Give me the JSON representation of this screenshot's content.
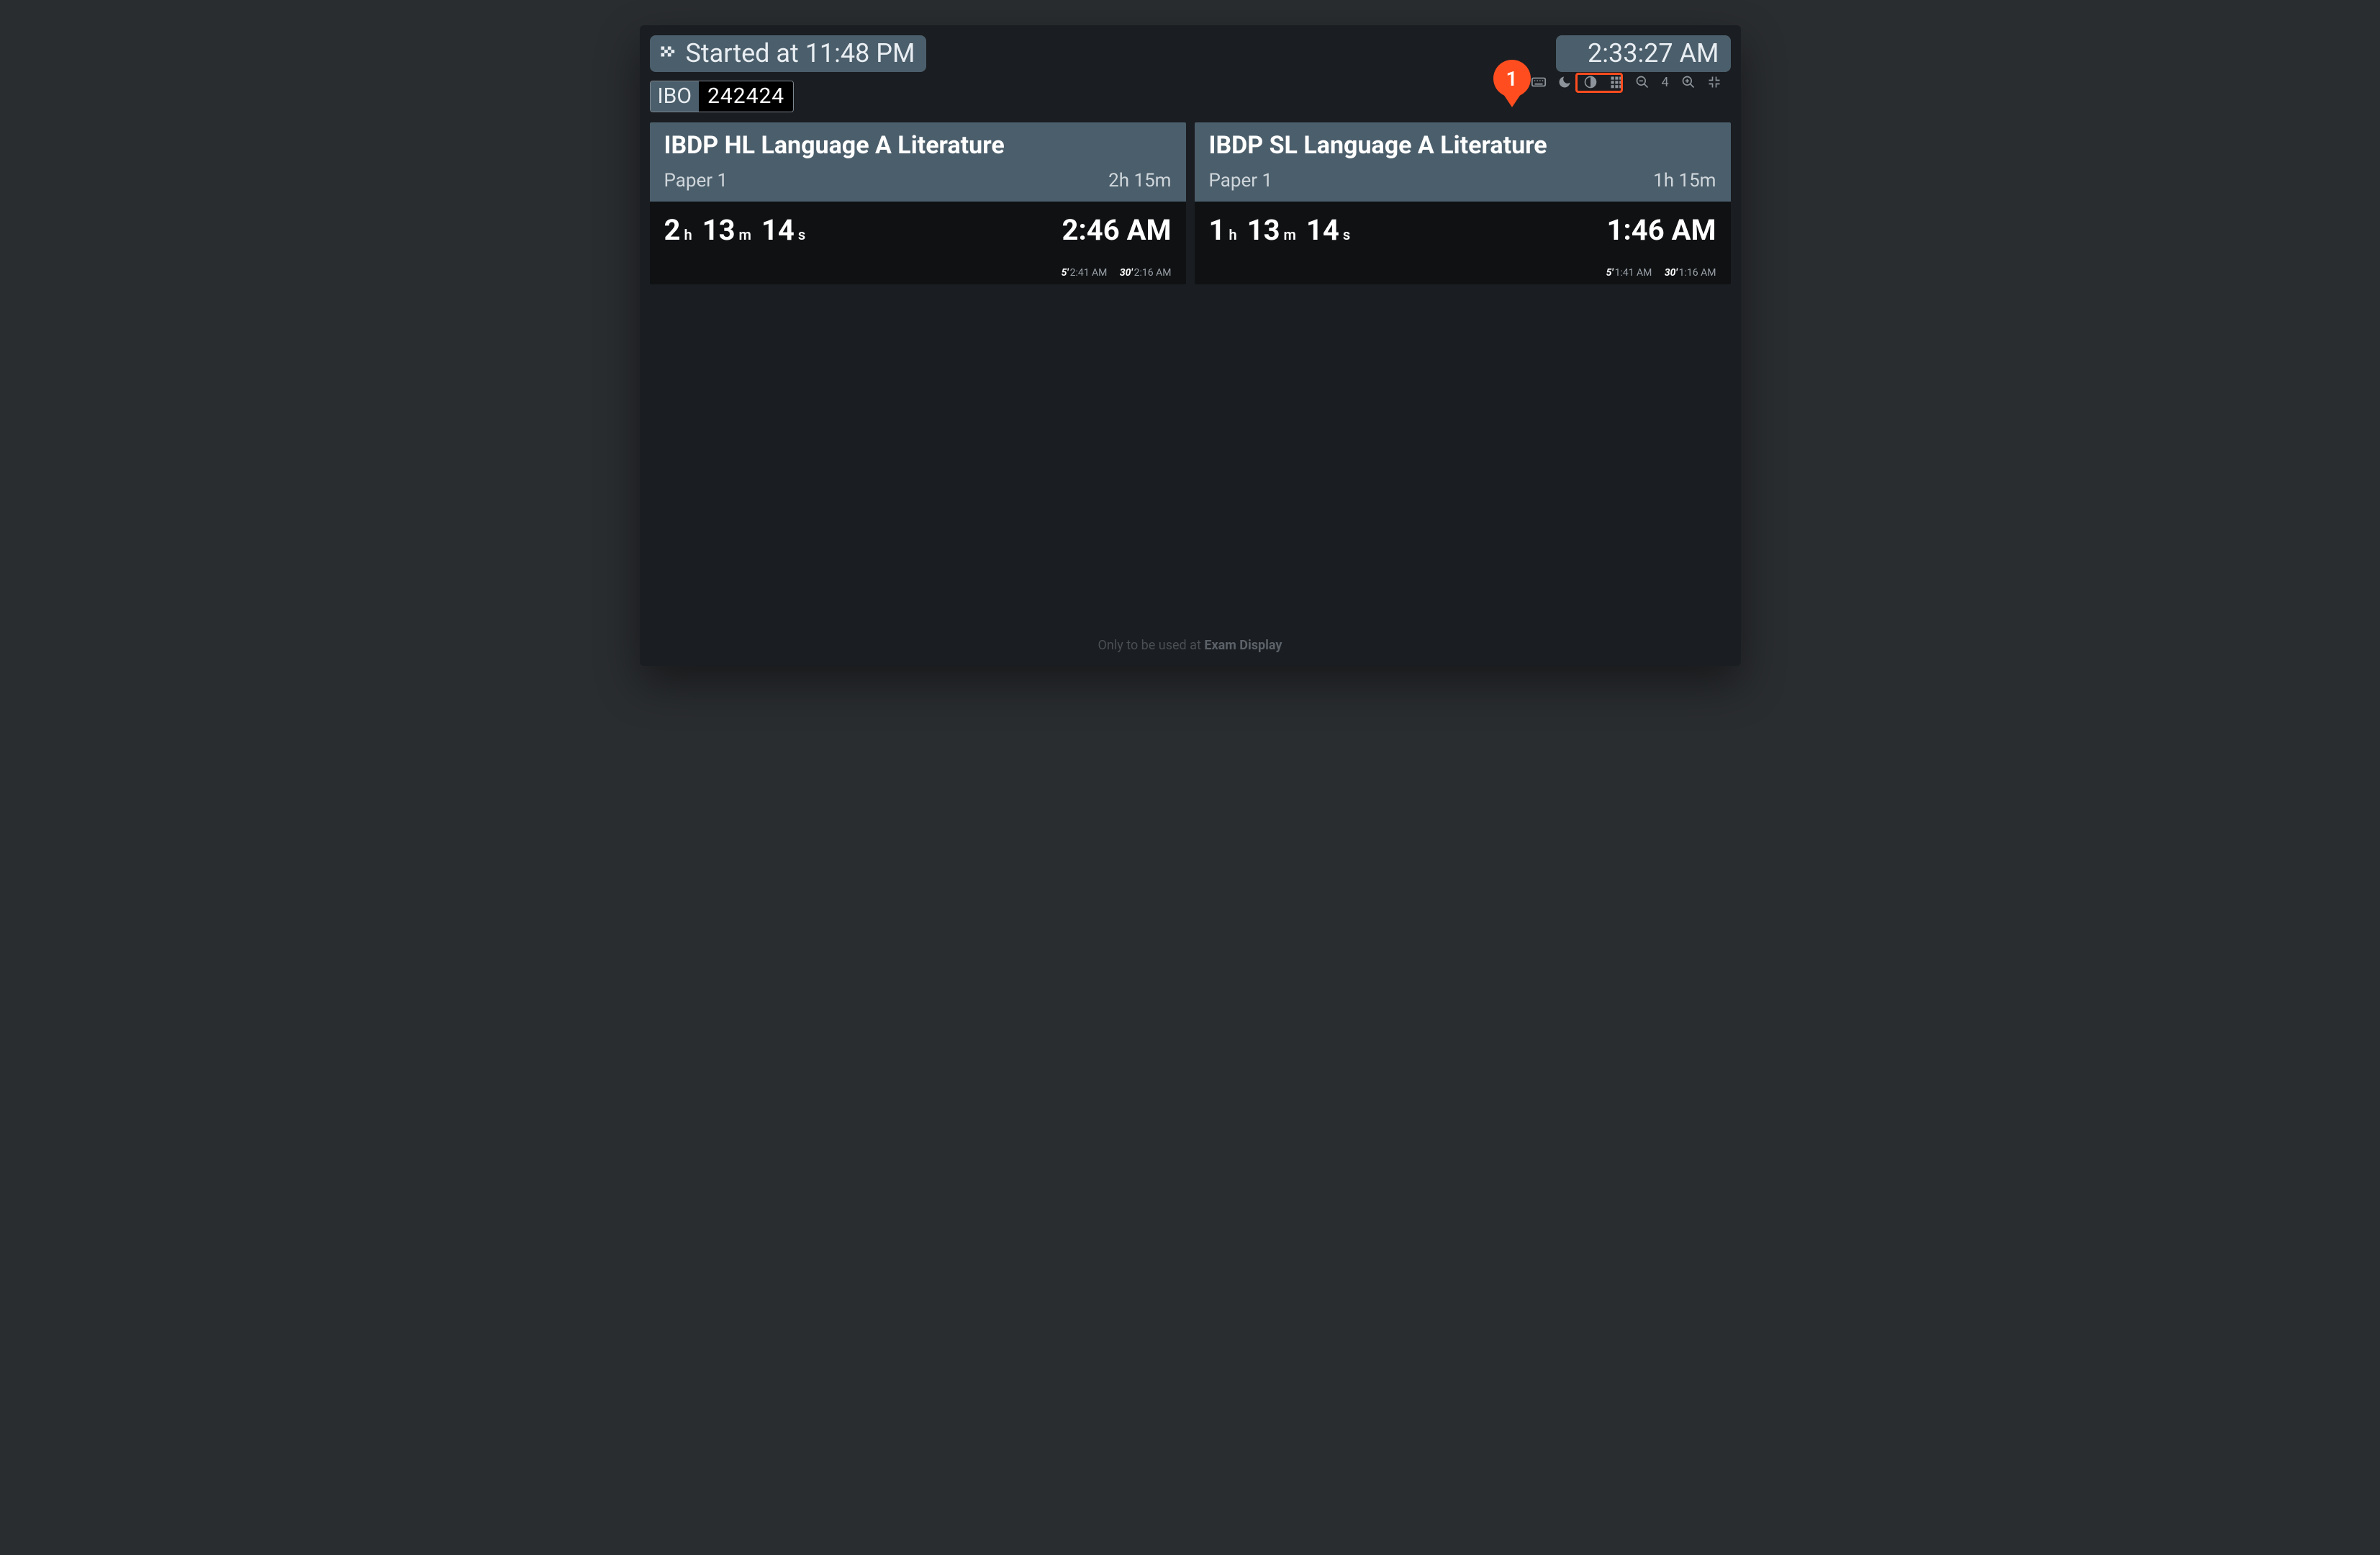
{
  "header": {
    "started_label": "Started at 11:48 PM",
    "clock": "2:33:27 AM",
    "code_label": "IBO",
    "code_value": "242424"
  },
  "callout": {
    "number": "1"
  },
  "toolbar": {
    "zoom_level": "4"
  },
  "cards": [
    {
      "title": "IBDP HL Language A Literature",
      "paper": "Paper 1",
      "duration": "2h 15m",
      "rem_h": "2",
      "rem_m": "13",
      "rem_s": "14",
      "end": "2:46 AM",
      "mark5_lbl": "5'",
      "mark5_time": "2:41 AM",
      "mark30_lbl": "30'",
      "mark30_time": "2:16 AM"
    },
    {
      "title": "IBDP SL Language A Literature",
      "paper": "Paper 1",
      "duration": "1h 15m",
      "rem_h": "1",
      "rem_m": "13",
      "rem_s": "14",
      "end": "1:46 AM",
      "mark5_lbl": "5'",
      "mark5_time": "1:41 AM",
      "mark30_lbl": "30'",
      "mark30_time": "1:16 AM"
    }
  ],
  "footer": {
    "prefix": "Only to be used at ",
    "brand": "Exam Display"
  },
  "units": {
    "h": "h",
    "m": "m",
    "s": "s"
  }
}
